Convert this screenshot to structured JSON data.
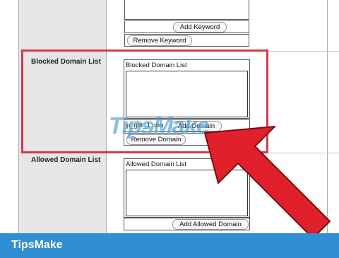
{
  "keyword": {
    "add_button": "Add Keyword",
    "remove_button": "Remove Keyword"
  },
  "blocked": {
    "row_label": "Blocked Domain List",
    "list_caption": "Blocked Domain List",
    "input_value": "p_gift_1.pho",
    "add_button": "Add Domain",
    "remove_button": "Remove Domain"
  },
  "allowed": {
    "row_label": "Allowed Domain List",
    "list_caption": "Allowed Domain List",
    "add_button": "Add Allowed Domain"
  },
  "watermark": "TipsMake",
  "footer": {
    "brand": "TipsMake"
  },
  "colors": {
    "highlight": "#d6394a",
    "arrow": "#e0202a",
    "footer": "#2f8fd2"
  }
}
